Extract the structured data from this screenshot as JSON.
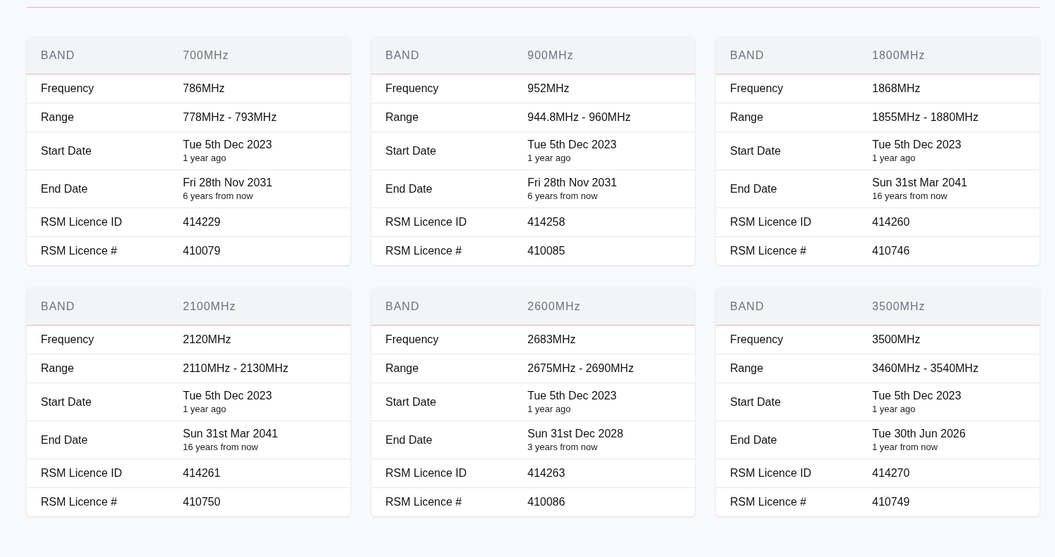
{
  "cards": [
    {
      "header": {
        "label": "BAND",
        "value": "700MHz"
      },
      "rows": [
        {
          "label": "Frequency",
          "value": "786MHz"
        },
        {
          "label": "Range",
          "value": "778MHz - 793MHz"
        },
        {
          "label": "Start Date",
          "value": "Tue 5th Dec 2023",
          "note": "1 year ago"
        },
        {
          "label": "End Date",
          "value": "Fri 28th Nov 2031",
          "note": "6 years from now"
        },
        {
          "label": "RSM Licence ID",
          "value": "414229"
        },
        {
          "label": "RSM Licence #",
          "value": "410079"
        }
      ]
    },
    {
      "header": {
        "label": "BAND",
        "value": "900MHz"
      },
      "rows": [
        {
          "label": "Frequency",
          "value": "952MHz"
        },
        {
          "label": "Range",
          "value": "944.8MHz - 960MHz"
        },
        {
          "label": "Start Date",
          "value": "Tue 5th Dec 2023",
          "note": "1 year ago"
        },
        {
          "label": "End Date",
          "value": "Fri 28th Nov 2031",
          "note": "6 years from now"
        },
        {
          "label": "RSM Licence ID",
          "value": "414258"
        },
        {
          "label": "RSM Licence #",
          "value": "410085"
        }
      ]
    },
    {
      "header": {
        "label": "BAND",
        "value": "1800MHz"
      },
      "rows": [
        {
          "label": "Frequency",
          "value": "1868MHz"
        },
        {
          "label": "Range",
          "value": "1855MHz - 1880MHz"
        },
        {
          "label": "Start Date",
          "value": "Tue 5th Dec 2023",
          "note": "1 year ago"
        },
        {
          "label": "End Date",
          "value": "Sun 31st Mar 2041",
          "note": "16 years from now"
        },
        {
          "label": "RSM Licence ID",
          "value": "414260"
        },
        {
          "label": "RSM Licence #",
          "value": "410746"
        }
      ]
    },
    {
      "header": {
        "label": "BAND",
        "value": "2100MHz"
      },
      "rows": [
        {
          "label": "Frequency",
          "value": "2120MHz"
        },
        {
          "label": "Range",
          "value": "2110MHz - 2130MHz"
        },
        {
          "label": "Start Date",
          "value": "Tue 5th Dec 2023",
          "note": "1 year ago"
        },
        {
          "label": "End Date",
          "value": "Sun 31st Mar 2041",
          "note": "16 years from now"
        },
        {
          "label": "RSM Licence ID",
          "value": "414261"
        },
        {
          "label": "RSM Licence #",
          "value": "410750"
        }
      ]
    },
    {
      "header": {
        "label": "BAND",
        "value": "2600MHz"
      },
      "rows": [
        {
          "label": "Frequency",
          "value": "2683MHz"
        },
        {
          "label": "Range",
          "value": "2675MHz - 2690MHz"
        },
        {
          "label": "Start Date",
          "value": "Tue 5th Dec 2023",
          "note": "1 year ago"
        },
        {
          "label": "End Date",
          "value": "Sun 31st Dec 2028",
          "note": "3 years from now"
        },
        {
          "label": "RSM Licence ID",
          "value": "414263"
        },
        {
          "label": "RSM Licence #",
          "value": "410086"
        }
      ]
    },
    {
      "header": {
        "label": "BAND",
        "value": "3500MHz"
      },
      "rows": [
        {
          "label": "Frequency",
          "value": "3500MHz"
        },
        {
          "label": "Range",
          "value": "3460MHz - 3540MHz"
        },
        {
          "label": "Start Date",
          "value": "Tue 5th Dec 2023",
          "note": "1 year ago"
        },
        {
          "label": "End Date",
          "value": "Tue 30th Jun 2026",
          "note": "1 year from now"
        },
        {
          "label": "RSM Licence ID",
          "value": "414270"
        },
        {
          "label": "RSM Licence #",
          "value": "410749"
        }
      ]
    }
  ]
}
